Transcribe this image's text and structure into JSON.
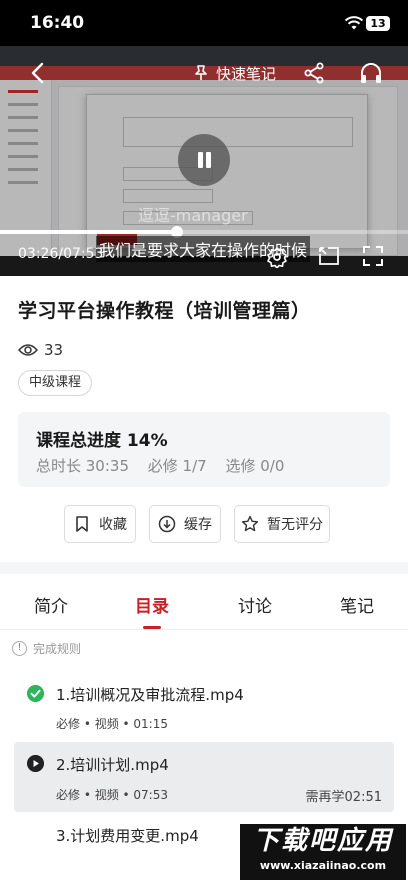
{
  "status_bar": {
    "time": "16:40",
    "battery": "13"
  },
  "player": {
    "quick_note_label": "快速笔记",
    "current_time": "03:26",
    "duration": "07:53",
    "time_display": "03:26/07:53",
    "progress_fraction": 0.435,
    "subtitle": "我们是要求大家在操作的时候",
    "watermark": "逗逗-manager"
  },
  "course": {
    "title": "学习平台操作教程（培训管理篇）",
    "view_count": "33",
    "level_tag": "中级课程"
  },
  "progress_card": {
    "label": "课程总进度 14%",
    "total_duration": "总时长 30:35",
    "required": "必修 1/7",
    "elective": "选修 0/0"
  },
  "actions": {
    "favorite": "收藏",
    "cache": "缓存",
    "rating": "暂无评分"
  },
  "tabs": {
    "intro": "简介",
    "catalog": "目录",
    "discussion": "讨论",
    "notes": "笔记",
    "active": "catalog"
  },
  "catalog": {
    "rules_label": "完成规则",
    "lessons": [
      {
        "title": "1.培训概况及审批流程.mp4",
        "meta": "必修 • 视频 • 01:15",
        "status": "completed"
      },
      {
        "title": "2.培训计划.mp4",
        "meta": "必修 • 视频 • 07:53",
        "status": "playing",
        "remaining": "需再学02:51"
      },
      {
        "title": "3.计划费用变更.mp4",
        "meta": "",
        "status": "pending"
      }
    ]
  },
  "watermark_logo": {
    "cn": "下载吧应用",
    "en": "www.xiazaiinao.com"
  },
  "colors": {
    "accent": "#c8202a",
    "completed": "#2db55d",
    "card_bg": "#f4f5f7"
  }
}
